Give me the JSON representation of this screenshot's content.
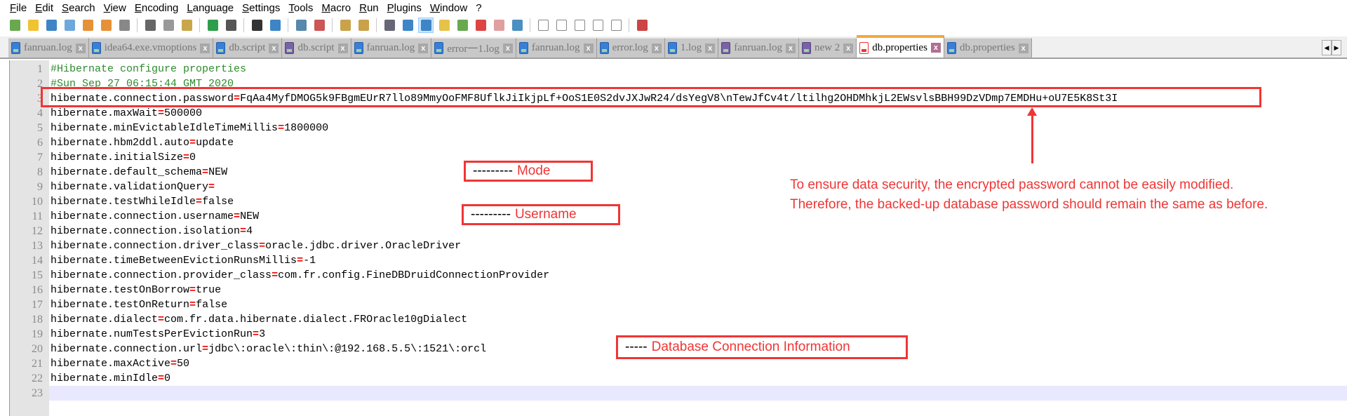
{
  "menu": [
    "File",
    "Edit",
    "Search",
    "View",
    "Encoding",
    "Language",
    "Settings",
    "Tools",
    "Macro",
    "Run",
    "Plugins",
    "Window",
    "?"
  ],
  "toolbar_icons": [
    "new-file-icon",
    "open-file-icon",
    "save-icon",
    "save-all-icon",
    "close-icon",
    "close-all-icon",
    "print-icon",
    "|",
    "cut-icon",
    "copy-icon",
    "paste-icon",
    "|",
    "undo-icon",
    "redo-icon",
    "|",
    "find-icon",
    "replace-icon",
    "|",
    "zoom-in-icon",
    "zoom-out-icon",
    "|",
    "sync-vertical-icon",
    "sync-horizontal-icon",
    "|",
    "word-wrap-icon",
    "show-all-chars-icon",
    "indent-guide-icon",
    "user-language-icon",
    "document-map-icon",
    "function-list-icon",
    "folder-workspace-icon",
    "monitor-icon",
    "|",
    "record-macro-icon",
    "stop-record-icon",
    "play-macro-icon",
    "run-macro-multiple-icon",
    "save-macro-icon",
    "|",
    "spell-check-icon"
  ],
  "tabs": [
    {
      "label": "fanruan.log",
      "color": "blue"
    },
    {
      "label": "idea64.exe.vmoptions",
      "color": "blue"
    },
    {
      "label": "db.script",
      "color": "blue"
    },
    {
      "label": "db.script",
      "color": "purple"
    },
    {
      "label": "fanruan.log",
      "color": "blue"
    },
    {
      "label": "error一1.log",
      "color": "blue"
    },
    {
      "label": "fanruan.log",
      "color": "blue"
    },
    {
      "label": "error.log",
      "color": "blue"
    },
    {
      "label": "1.log",
      "color": "blue"
    },
    {
      "label": "fanruan.log",
      "color": "purple"
    },
    {
      "label": "new 2",
      "color": "purple"
    },
    {
      "label": "db.properties",
      "color": "red",
      "active": true
    },
    {
      "label": "db.properties",
      "color": "blue"
    }
  ],
  "lines": [
    {
      "comment": "#Hibernate configure properties"
    },
    {
      "comment": "#Sun Sep 27 06:15:44 GMT 2020"
    },
    {
      "key": "hibernate.connection.password",
      "value": "FqAa4MyfDMOG5k9FBgmEUrR7llo89MmyOoFMF8UflkJiIkjpLf+OoS1E0S2dvJXJwR24/dsYegV8\\nTewJfCv4t/ltilhg2OHDMhkjL2EWsvlsBBH99DzVDmp7EMDHu+oU7E5K8St3I"
    },
    {
      "key": "hibernate.maxWait",
      "value": "500000"
    },
    {
      "key": "hibernate.minEvictableIdleTimeMillis",
      "value": "1800000"
    },
    {
      "key": "hibernate.hbm2ddl.auto",
      "value": "update"
    },
    {
      "key": "hibernate.initialSize",
      "value": "0"
    },
    {
      "key": "hibernate.default_schema",
      "value": "NEW"
    },
    {
      "key": "hibernate.validationQuery",
      "value": ""
    },
    {
      "key": "hibernate.testWhileIdle",
      "value": "false"
    },
    {
      "key": "hibernate.connection.username",
      "value": "NEW"
    },
    {
      "key": "hibernate.connection.isolation",
      "value": "4"
    },
    {
      "key": "hibernate.connection.driver_class",
      "value": "oracle.jdbc.driver.OracleDriver"
    },
    {
      "key": "hibernate.timeBetweenEvictionRunsMillis",
      "value": "-1"
    },
    {
      "key": "hibernate.connection.provider_class",
      "value": "com.fr.config.FineDBDruidConnectionProvider"
    },
    {
      "key": "hibernate.testOnBorrow",
      "value": "true"
    },
    {
      "key": "hibernate.testOnReturn",
      "value": "false"
    },
    {
      "key": "hibernate.dialect",
      "value": "com.fr.data.hibernate.dialect.FROracle10gDialect"
    },
    {
      "key": "hibernate.numTestsPerEvictionRun",
      "value": "3"
    },
    {
      "key": "hibernate.connection.url",
      "value": "jdbc\\:oracle\\:thin\\:@192.168.5.5\\:1521\\:orcl"
    },
    {
      "key": "hibernate.maxActive",
      "value": "50"
    },
    {
      "key": "hibernate.minIdle",
      "value": "0"
    },
    {
      "empty": true,
      "current": true
    }
  ],
  "annotations": {
    "mode": {
      "dash": "---------",
      "label": "Mode"
    },
    "username": {
      "dash": "---------",
      "label": "Username"
    },
    "db": {
      "dash": "-----",
      "label": "Database Connection Information"
    },
    "note_line1": "To ensure data security, the encrypted password cannot be easily modified.",
    "note_line2": "Therefore, the backed-up database password should remain the same as before."
  },
  "colors": {
    "annotation": "#f03535",
    "active_tab": "#f4a83a",
    "comment": "#2e8b2e"
  }
}
